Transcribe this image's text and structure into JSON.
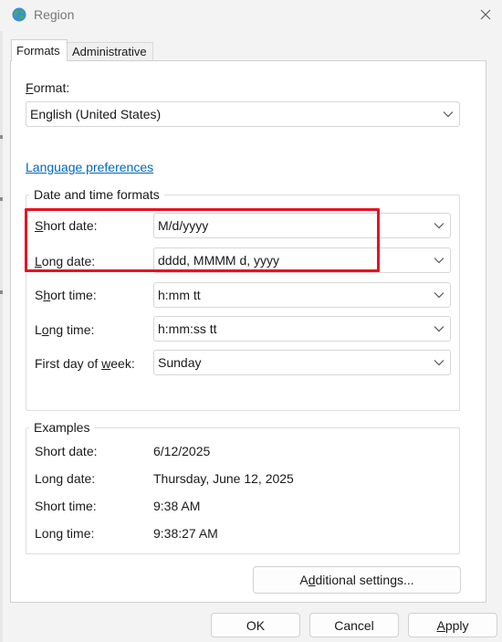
{
  "window": {
    "title": "Region",
    "icon": "globe-icon"
  },
  "tabs": [
    {
      "label": "Formats",
      "active": true
    },
    {
      "label": "Administrative",
      "active": false
    }
  ],
  "format": {
    "label_hotkey": "F",
    "label_rest": "ormat:",
    "value": "English (United States)"
  },
  "language_link": "Language preferences",
  "date_time_formats": {
    "legend": "Date and time formats",
    "rows": [
      {
        "label_pre": "",
        "label_hotkey": "S",
        "label_post": "hort date:",
        "value": "M/d/yyyy"
      },
      {
        "label_pre": "",
        "label_hotkey": "L",
        "label_post": "ong date:",
        "value": "dddd, MMMM d, yyyy"
      },
      {
        "label_pre": "S",
        "label_hotkey": "h",
        "label_post": "ort time:",
        "value": "h:mm tt"
      },
      {
        "label_pre": "L",
        "label_hotkey": "o",
        "label_post": "ng time:",
        "value": "h:mm:ss tt"
      },
      {
        "label_pre": "First day of ",
        "label_hotkey": "w",
        "label_post": "eek:",
        "value": "Sunday"
      }
    ]
  },
  "examples": {
    "legend": "Examples",
    "rows": [
      {
        "label": "Short date:",
        "value": "6/12/2025"
      },
      {
        "label": "Long date:",
        "value": "Thursday, June 12, 2025"
      },
      {
        "label": "Short time:",
        "value": "9:38 AM"
      },
      {
        "label": "Long time:",
        "value": "9:38:27 AM"
      }
    ]
  },
  "additional_settings": {
    "pre": "A",
    "hotkey": "d",
    "post": "ditional settings..."
  },
  "buttons": {
    "ok": "OK",
    "cancel": "Cancel",
    "apply_hotkey": "A",
    "apply_rest": "pply"
  },
  "colors": {
    "highlight": "#e81123",
    "link": "#0067c0"
  }
}
